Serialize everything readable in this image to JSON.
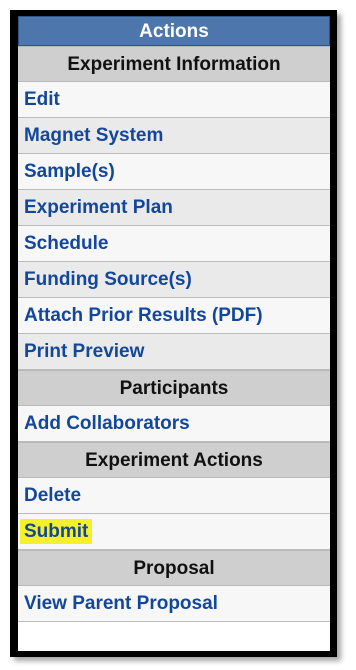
{
  "header": {
    "title": "Actions"
  },
  "sections": [
    {
      "title": "Experiment Information",
      "items": [
        "Edit",
        "Magnet System",
        "Sample(s)",
        "Experiment Plan",
        "Schedule",
        "Funding Source(s)",
        "Attach Prior Results (PDF)",
        "Print Preview"
      ]
    },
    {
      "title": "Participants",
      "items": [
        "Add Collaborators"
      ]
    },
    {
      "title": "Experiment Actions",
      "items": [
        "Delete",
        "Submit"
      ],
      "highlighted_item": "Submit"
    },
    {
      "title": "Proposal",
      "items": [
        "View Parent Proposal"
      ]
    }
  ],
  "colors": {
    "header_bg": "#4d76ad",
    "section_bg": "#cfcfcf",
    "link_text": "#12479b",
    "highlight": "#f4f12c"
  }
}
